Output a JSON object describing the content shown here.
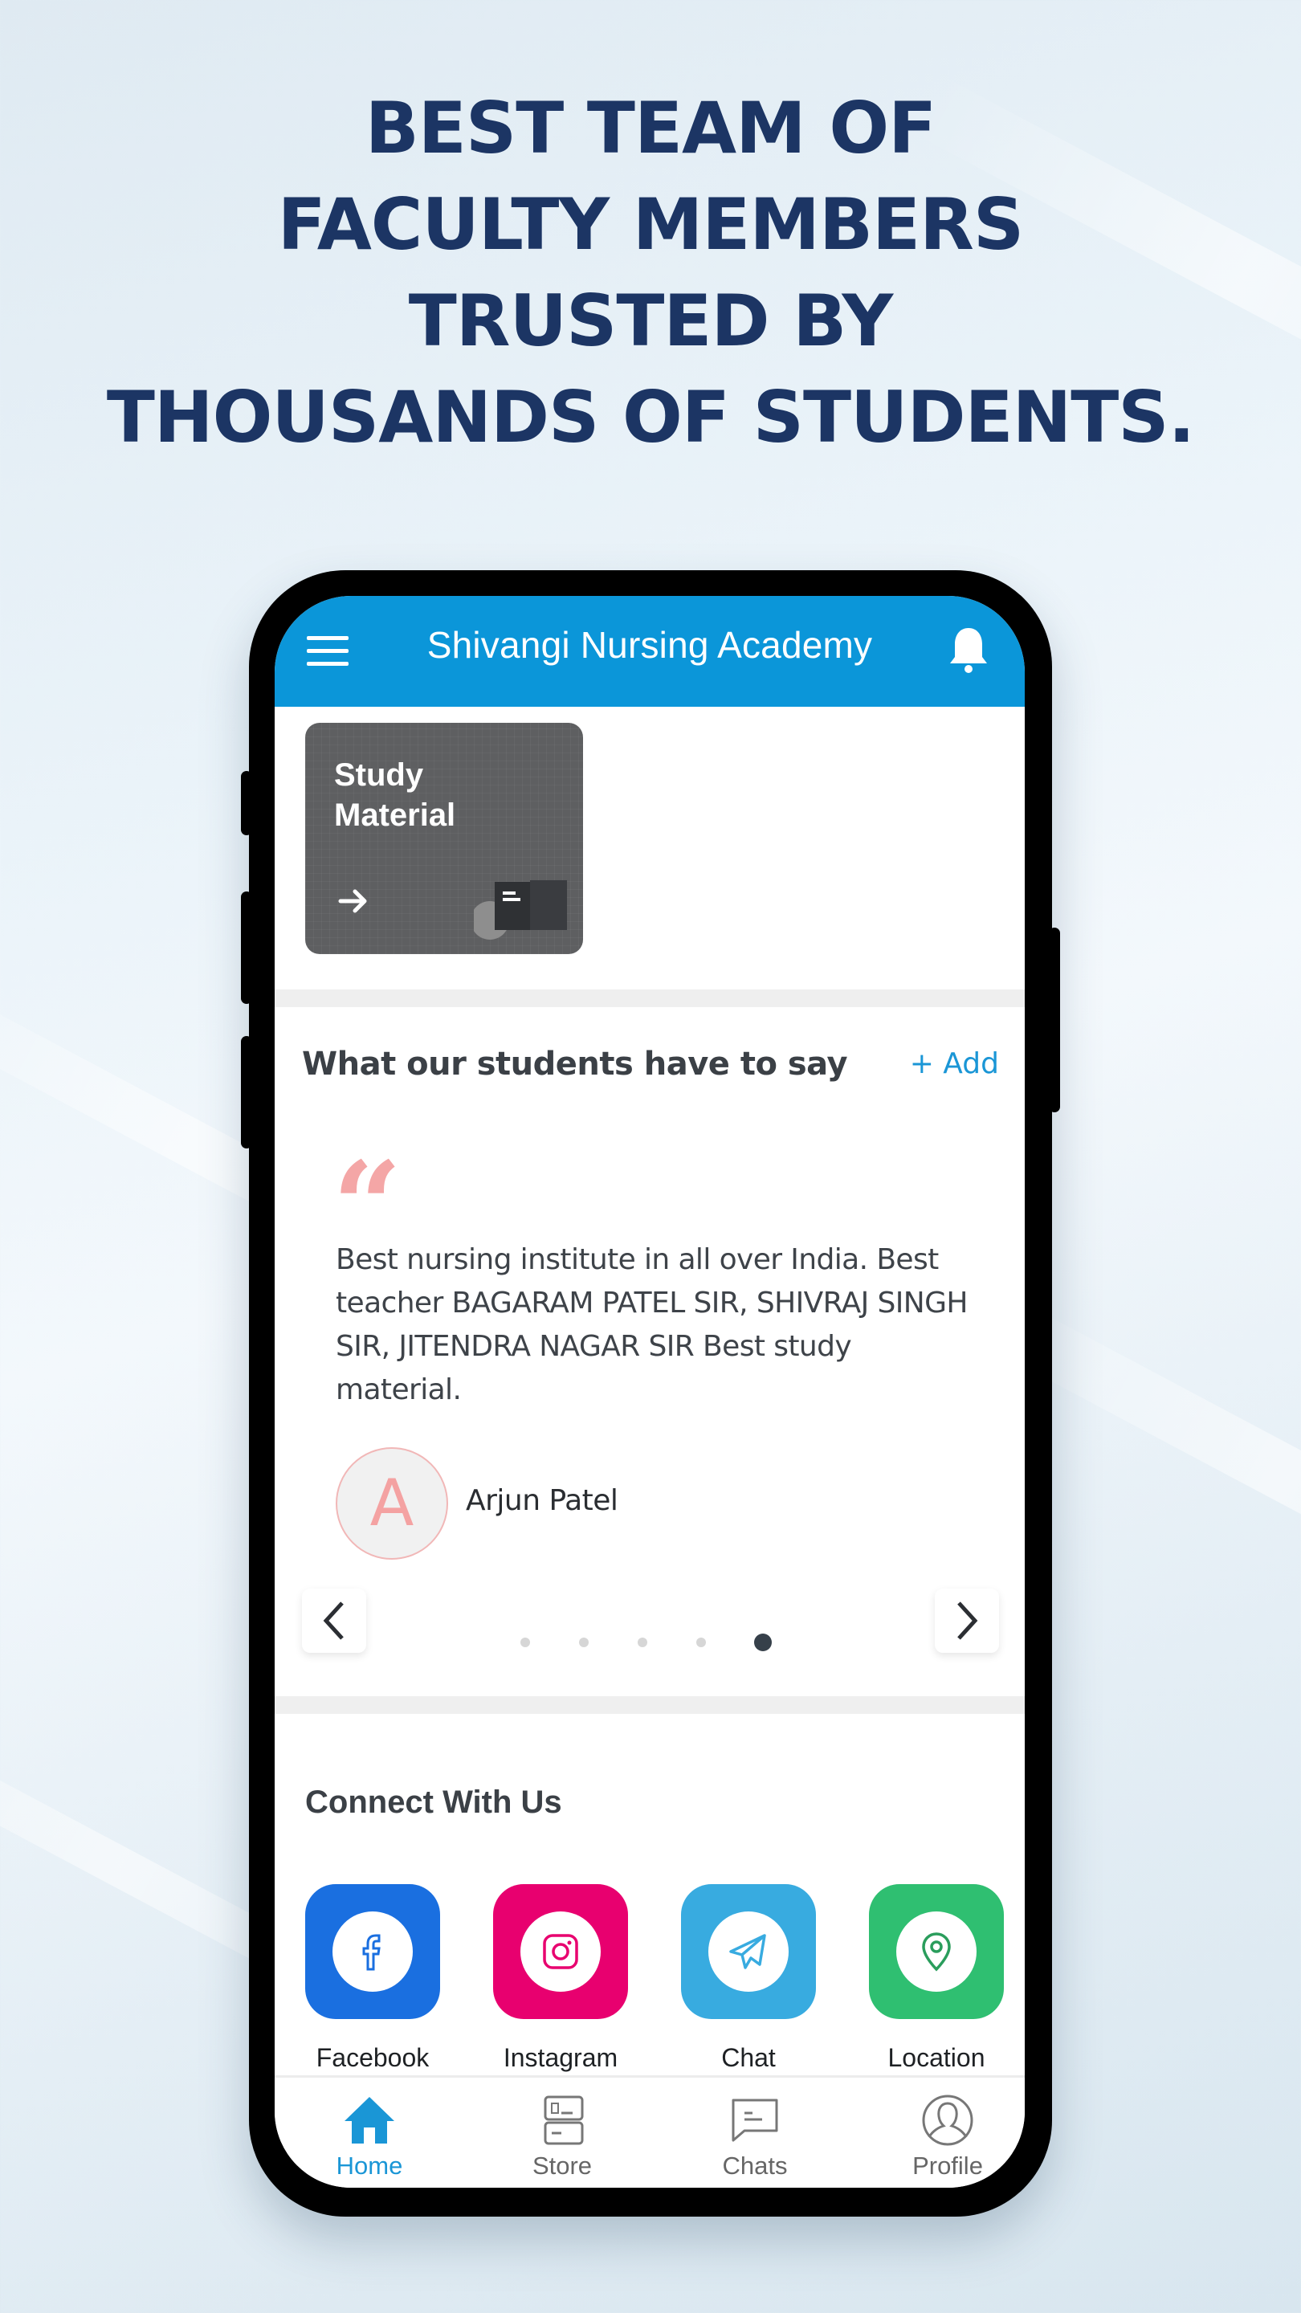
{
  "headline": {
    "lines": [
      "BEST TEAM OF",
      "FACULTY MEMBERS",
      "TRUSTED BY",
      "THOUSANDS OF STUDENTS."
    ]
  },
  "app": {
    "title": "Shivangi Nursing Academy",
    "menu_icon": "hamburger-menu-icon",
    "notification_icon": "bell-icon"
  },
  "study_card": {
    "line1": "Study",
    "line2": "Material",
    "arrow_icon": "arrow-right-icon",
    "illustration_icon": "open-book-icon"
  },
  "testimonials": {
    "title": "What our students have to say",
    "add_label": "+ Add",
    "quote_glyph": "“",
    "text": "Best nursing institute in all over India. Best teacher BAGARAM PATEL SIR, SHIVRAJ SINGH SIR, JITENDRA NAGAR SIR Best study material.",
    "author_initial": "A",
    "author_name": "Arjun Patel",
    "slide_count": 5,
    "active_slide": 5,
    "prev_icon": "chevron-left-icon",
    "next_icon": "chevron-right-icon"
  },
  "connect": {
    "title": "Connect With Us",
    "items": [
      {
        "label": "Facebook",
        "icon": "facebook-icon",
        "color": "#1a6fe0"
      },
      {
        "label": "Instagram",
        "icon": "instagram-icon",
        "color": "#e8006f"
      },
      {
        "label": "Chat",
        "icon": "telegram-icon",
        "color": "#38abe0"
      },
      {
        "label": "Location",
        "icon": "location-pin-icon",
        "color": "#2fbf71"
      }
    ]
  },
  "bottom_nav": {
    "items": [
      {
        "label": "Home",
        "icon": "home-icon",
        "active": true
      },
      {
        "label": "Store",
        "icon": "books-icon",
        "active": false
      },
      {
        "label": "Chats",
        "icon": "chat-bubble-icon",
        "active": false
      },
      {
        "label": "Profile",
        "icon": "user-profile-icon",
        "active": false
      }
    ],
    "active_color": "#1a96d6",
    "inactive_color": "#666666"
  },
  "colors": {
    "headline": "#1c3564",
    "appbar": "#0b96d9",
    "accent": "#1a96d6",
    "quote": "#f4a6a6"
  }
}
